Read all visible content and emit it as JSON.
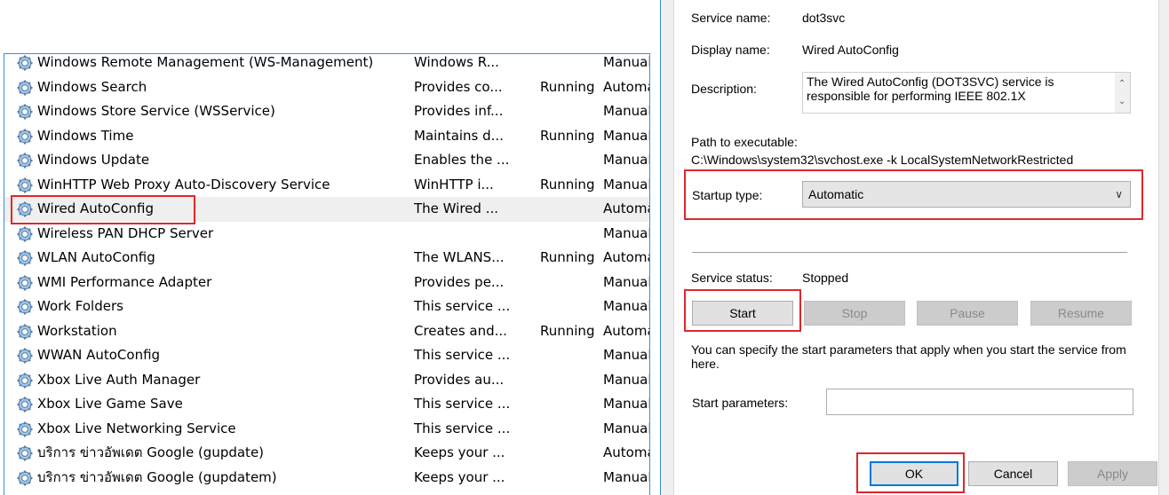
{
  "services": [
    {
      "name": "Windows Remote Management (WS-Management)",
      "description": "Windows R...",
      "status": "",
      "startup": "Manual",
      "partial": true
    },
    {
      "name": "Windows Search",
      "description": "Provides co...",
      "status": "Running",
      "startup": "Automatic"
    },
    {
      "name": "Windows Store Service (WSService)",
      "description": "Provides inf...",
      "status": "",
      "startup": "Manual"
    },
    {
      "name": "Windows Time",
      "description": "Maintains d...",
      "status": "Running",
      "startup": "Manual"
    },
    {
      "name": "Windows Update",
      "description": "Enables the ...",
      "status": "",
      "startup": "Manual"
    },
    {
      "name": "WinHTTP Web Proxy Auto-Discovery Service",
      "description": "WinHTTP i...",
      "status": "Running",
      "startup": "Manual"
    },
    {
      "name": "Wired AutoConfig",
      "description": "The Wired ...",
      "status": "",
      "startup": "Automatic",
      "selected": true
    },
    {
      "name": "Wireless PAN DHCP Server",
      "description": "",
      "status": "",
      "startup": "Manual"
    },
    {
      "name": "WLAN AutoConfig",
      "description": "The WLANS...",
      "status": "Running",
      "startup": "Automatic"
    },
    {
      "name": "WMI Performance Adapter",
      "description": "Provides pe...",
      "status": "",
      "startup": "Manual"
    },
    {
      "name": "Work Folders",
      "description": "This service ...",
      "status": "",
      "startup": "Manual"
    },
    {
      "name": "Workstation",
      "description": "Creates and...",
      "status": "Running",
      "startup": "Automatic"
    },
    {
      "name": "WWAN AutoConfig",
      "description": "This service ...",
      "status": "",
      "startup": "Manual"
    },
    {
      "name": "Xbox Live Auth Manager",
      "description": "Provides au...",
      "status": "",
      "startup": "Manual"
    },
    {
      "name": "Xbox Live Game Save",
      "description": "This service ...",
      "status": "",
      "startup": "Manual"
    },
    {
      "name": "Xbox Live Networking Service",
      "description": "This service ...",
      "status": "",
      "startup": "Manual"
    },
    {
      "name": "บริการ ข่าวอัพเดต Google (gupdate)",
      "description": "Keeps your ...",
      "status": "",
      "startup": "Automatic"
    },
    {
      "name": "บริการ ข่าวอัพเดต Google (gupdatem)",
      "description": "Keeps your ...",
      "status": "",
      "startup": "Manual"
    }
  ],
  "dialog": {
    "service_name_label": "Service name:",
    "service_name": "dot3svc",
    "display_name_label": "Display name:",
    "display_name": "Wired AutoConfig",
    "description_label": "Description:",
    "description": "The Wired AutoConfig (DOT3SVC) service is responsible for performing IEEE 802.1X",
    "path_label": "Path to executable:",
    "path": "C:\\Windows\\system32\\svchost.exe -k LocalSystemNetworkRestricted",
    "startup_type_label": "Startup type:",
    "startup_type": "Automatic",
    "service_status_label": "Service status:",
    "service_status": "Stopped",
    "start_label": "Start",
    "stop_label": "Stop",
    "pause_label": "Pause",
    "resume_label": "Resume",
    "hint": "You can specify the start parameters that apply when you start the service from here.",
    "start_params_label": "Start parameters:",
    "start_params_value": "",
    "ok_label": "OK",
    "cancel_label": "Cancel",
    "apply_label": "Apply"
  },
  "colors": {
    "highlight": "#e0262c",
    "window_border": "#3c8fd6",
    "selected_row": "#efefef"
  },
  "icons": {
    "service": "gear-icon",
    "scroll_up": "chevron-up-icon",
    "scroll_down": "chevron-down-icon",
    "dropdown": "chevron-down-icon"
  }
}
